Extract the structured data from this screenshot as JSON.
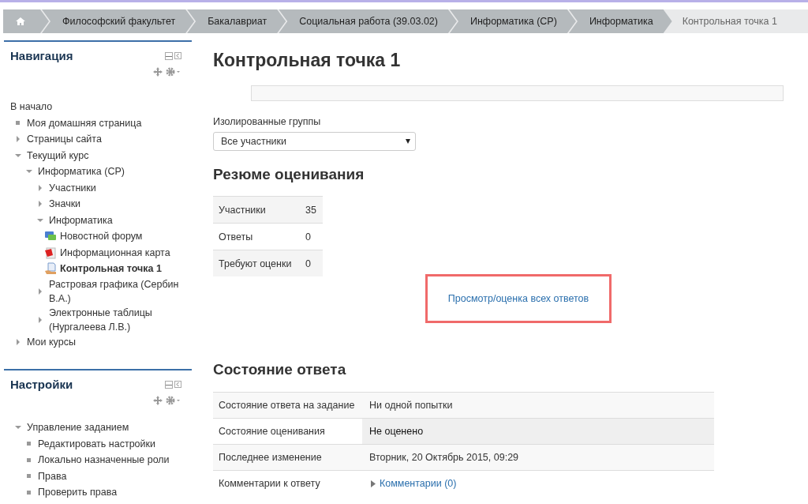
{
  "breadcrumb": [
    {
      "kind": "home",
      "current": false
    },
    {
      "kind": "link",
      "text": "Философский факультет",
      "current": false
    },
    {
      "kind": "link",
      "text": "Бакалавриат",
      "current": false
    },
    {
      "kind": "link",
      "text": "Социальная работа (39.03.02)",
      "current": false
    },
    {
      "kind": "link",
      "text": "Информатика (СР)",
      "current": false
    },
    {
      "kind": "link",
      "text": "Информатика",
      "current": false
    },
    {
      "kind": "link",
      "text": "Контрольная точка 1",
      "current": true
    }
  ],
  "navigation": {
    "title": "Навигация",
    "items": [
      {
        "kind": "home",
        "text": "В начало"
      },
      {
        "kind": "leaf",
        "text": "Моя домашняя страница"
      },
      {
        "kind": "branch",
        "text": "Страницы сайта",
        "expanded": false
      },
      {
        "kind": "branch",
        "text": "Текущий курс",
        "expanded": true,
        "children": [
          {
            "kind": "branch",
            "text": "Информатика (СР)",
            "expanded": true,
            "children": [
              {
                "kind": "branch",
                "text": "Участники",
                "expanded": false
              },
              {
                "kind": "branch",
                "text": "Значки",
                "expanded": false
              },
              {
                "kind": "branch",
                "text": "Информатика",
                "expanded": true,
                "children": [
                  {
                    "kind": "forum",
                    "text": "Новостной форум",
                    "selected": false
                  },
                  {
                    "kind": "resource",
                    "text": "Информационная карта",
                    "selected": false
                  },
                  {
                    "kind": "assignment",
                    "text": "Контрольная точка 1",
                    "selected": true
                  }
                ]
              },
              {
                "kind": "branch",
                "text": "Растровая графика (Сербин В.А.)",
                "expanded": false
              },
              {
                "kind": "branch",
                "text": "Электронные таблицы (Нургалеева Л.В.)",
                "expanded": false
              }
            ]
          }
        ]
      },
      {
        "kind": "branch",
        "text": "Мои курсы",
        "expanded": false
      }
    ]
  },
  "settings": {
    "title": "Настройки",
    "items": [
      {
        "kind": "branch",
        "text": "Управление заданием",
        "expanded": true,
        "children": [
          {
            "kind": "leaf",
            "text": "Редактировать настройки"
          },
          {
            "kind": "leaf",
            "text": "Локально назначенные роли"
          },
          {
            "kind": "leaf",
            "text": "Права"
          },
          {
            "kind": "leaf",
            "text": "Проверить права"
          }
        ]
      }
    ]
  },
  "page_title": "Контрольная точка 1",
  "group_filter": {
    "label": "Изолированные группы",
    "value": "Все участники"
  },
  "summary": {
    "title": "Резюме оценивания",
    "rows": [
      {
        "label": "Участники",
        "value": "35"
      },
      {
        "label": "Ответы",
        "value": "0"
      },
      {
        "label": "Требуют оценки",
        "value": "0"
      }
    ]
  },
  "grading_link": {
    "text": "Просмотр/оценка всех ответов",
    "highlighted": true
  },
  "submission_status": {
    "title": "Состояние ответа",
    "rows": [
      {
        "kind": "plain",
        "label": "Состояние ответа на задание",
        "value": "Ни одной попытки"
      },
      {
        "kind": "status",
        "label": "Состояние оценивания",
        "value": "Не оценено"
      },
      {
        "kind": "plain",
        "label": "Последнее изменение",
        "value": "Вторник, 20 Октябрь 2015, 09:29"
      },
      {
        "kind": "comments",
        "label": "Комментарии к ответу",
        "value": "Комментарии (0)"
      }
    ]
  }
}
